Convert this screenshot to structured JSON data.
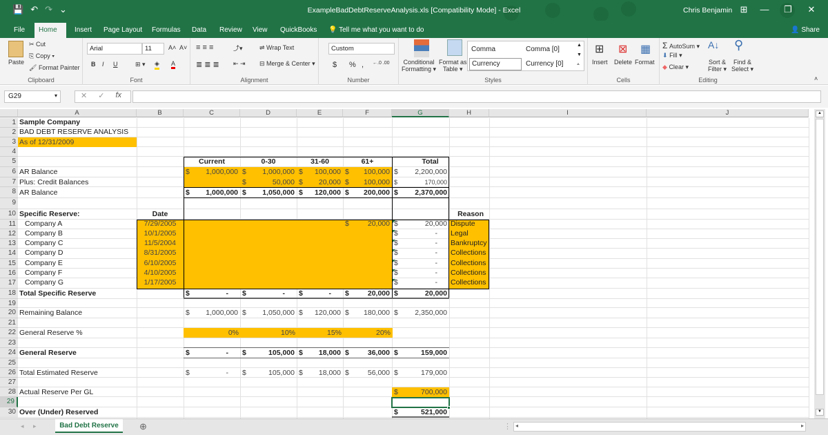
{
  "window": {
    "title": "ExampleBadDebtReserveAnalysis.xls  [Compatibility Mode] - Excel",
    "user": "Chris Benjamin",
    "qat": {
      "save_icon": "💾",
      "undo_icon": "↶",
      "redo_icon": "↷",
      "customize_icon": "⌄"
    },
    "controls": {
      "ribbon_display": "⊞",
      "minimize": "—",
      "restore": "❐",
      "close": "✕"
    }
  },
  "tabs": [
    {
      "label": "File"
    },
    {
      "label": "Home"
    },
    {
      "label": "Insert"
    },
    {
      "label": "Page Layout"
    },
    {
      "label": "Formulas"
    },
    {
      "label": "Data"
    },
    {
      "label": "Review"
    },
    {
      "label": "View"
    },
    {
      "label": "QuickBooks"
    }
  ],
  "active_tab": "Home",
  "tell_me": "Tell me what you want to do",
  "share": "Share",
  "ribbon": {
    "clipboard": {
      "paste": "Paste",
      "cut": "Cut",
      "copy": "Copy",
      "format_painter": "Format Painter",
      "group": "Clipboard"
    },
    "font": {
      "name": "Arial",
      "size": "11",
      "bold": "B",
      "italic": "I",
      "underline": "U",
      "group": "Font",
      "grow": "A˄",
      "shrink": "A˅"
    },
    "alignment": {
      "wrap": "Wrap Text",
      "merge": "Merge & Center",
      "group": "Alignment"
    },
    "number": {
      "format": "Custom",
      "currency": "$",
      "percent": "%",
      "comma": ",",
      "inc_dec": "←.0 .00",
      "dec_dec": ".00 →.0",
      "group": "Number"
    },
    "styles": {
      "conditional": "Conditional",
      "conditional2": "Formatting",
      "format_as": "Format as",
      "format_as2": "Table",
      "comma": "Comma",
      "comma0": "Comma [0]",
      "currency": "Currency",
      "currency0": "Currency [0]",
      "group": "Styles"
    },
    "cells": {
      "insert": "Insert",
      "delete": "Delete",
      "format": "Format",
      "group": "Cells"
    },
    "editing": {
      "autosum": "AutoSum",
      "fill": "Fill",
      "clear": "Clear",
      "sort": "Sort &",
      "sort2": "Filter",
      "find": "Find &",
      "find2": "Select",
      "group": "Editing"
    }
  },
  "formula_bar": {
    "name_box": "G29",
    "cancel": "✕",
    "enter": "✓",
    "fx": "fx",
    "value": ""
  },
  "columns": [
    "A",
    "B",
    "C",
    "D",
    "E",
    "F",
    "G",
    "H",
    "I",
    "J"
  ],
  "selected_cell": "G29",
  "rows": [
    "1",
    "2",
    "3",
    "4",
    "5",
    "6",
    "7",
    "8",
    "9",
    "10",
    "11",
    "12",
    "13",
    "14",
    "15",
    "16",
    "17",
    "18",
    "19",
    "20",
    "21",
    "22",
    "23",
    "24",
    "25",
    "26",
    "27",
    "28",
    "29",
    "30"
  ],
  "sheet": {
    "a1": "Sample Company",
    "a2": "BAD DEBT RESERVE ANALYSIS",
    "a3": "As of 12/31/2009",
    "headers": {
      "current": "Current",
      "d030": "0-30",
      "d3160": "31-60",
      "d61": "61+",
      "total": "Total"
    },
    "a6": "AR Balance",
    "a7": "Plus: Credit Balances",
    "a8": "AR Balance",
    "r6": {
      "c": "1,000,000",
      "d": "1,000,000",
      "e": "100,000",
      "f": "100,000",
      "g": "2,200,000"
    },
    "r7": {
      "d": "50,000",
      "e": "20,000",
      "f": "100,000",
      "g": "170,000"
    },
    "r8": {
      "c": "1,000,000",
      "d": "1,050,000",
      "e": "120,000",
      "f": "200,000",
      "g": "2,370,000"
    },
    "a10": "Specific Reserve:",
    "b10": "Date",
    "h10": "Reason",
    "specific": [
      {
        "name": "Company A",
        "date": "7/29/2005",
        "f": "20,000",
        "g": "20,000",
        "reason": "Dispute"
      },
      {
        "name": "Company B",
        "date": "10/1/2005",
        "f": "",
        "g": "-",
        "reason": "Legal"
      },
      {
        "name": "Company C",
        "date": "11/5/2004",
        "f": "",
        "g": "-",
        "reason": "Bankruptcy"
      },
      {
        "name": "Company D",
        "date": "8/31/2005",
        "f": "",
        "g": "-",
        "reason": "Collections"
      },
      {
        "name": "Company E",
        "date": "6/10/2005",
        "f": "",
        "g": "-",
        "reason": "Collections"
      },
      {
        "name": "Company F",
        "date": "4/10/2005",
        "f": "",
        "g": "-",
        "reason": "Collections"
      },
      {
        "name": "Company G",
        "date": "1/17/2005",
        "f": "",
        "g": "-",
        "reason": "Collections"
      }
    ],
    "a18": "Total Specific Reserve",
    "r18": {
      "c": "-",
      "d": "-",
      "e": "-",
      "f": "20,000",
      "g": "20,000"
    },
    "a20": "Remaining Balance",
    "r20": {
      "c": "1,000,000",
      "d": "1,050,000",
      "e": "120,000",
      "f": "180,000",
      "g": "2,350,000"
    },
    "a22": "General Reserve %",
    "r22": {
      "c": "0%",
      "d": "10%",
      "e": "15%",
      "f": "20%"
    },
    "a24": "General Reserve",
    "r24": {
      "c": "-",
      "d": "105,000",
      "e": "18,000",
      "f": "36,000",
      "g": "159,000"
    },
    "a26": "Total Estimated Reserve",
    "r26": {
      "c": "-",
      "d": "105,000",
      "e": "18,000",
      "f": "56,000",
      "g": "179,000"
    },
    "a28": "Actual Reserve Per GL",
    "g28": "700,000",
    "a30": "Over (Under) Reserved",
    "g30": "521,000",
    "dollar": "$"
  },
  "sheet_tabs": [
    {
      "label": "Bad Debt Reserve"
    }
  ],
  "add_sheet": "⊕",
  "colors": {
    "excel_green": "#217346",
    "input_fill": "#ffc000"
  }
}
